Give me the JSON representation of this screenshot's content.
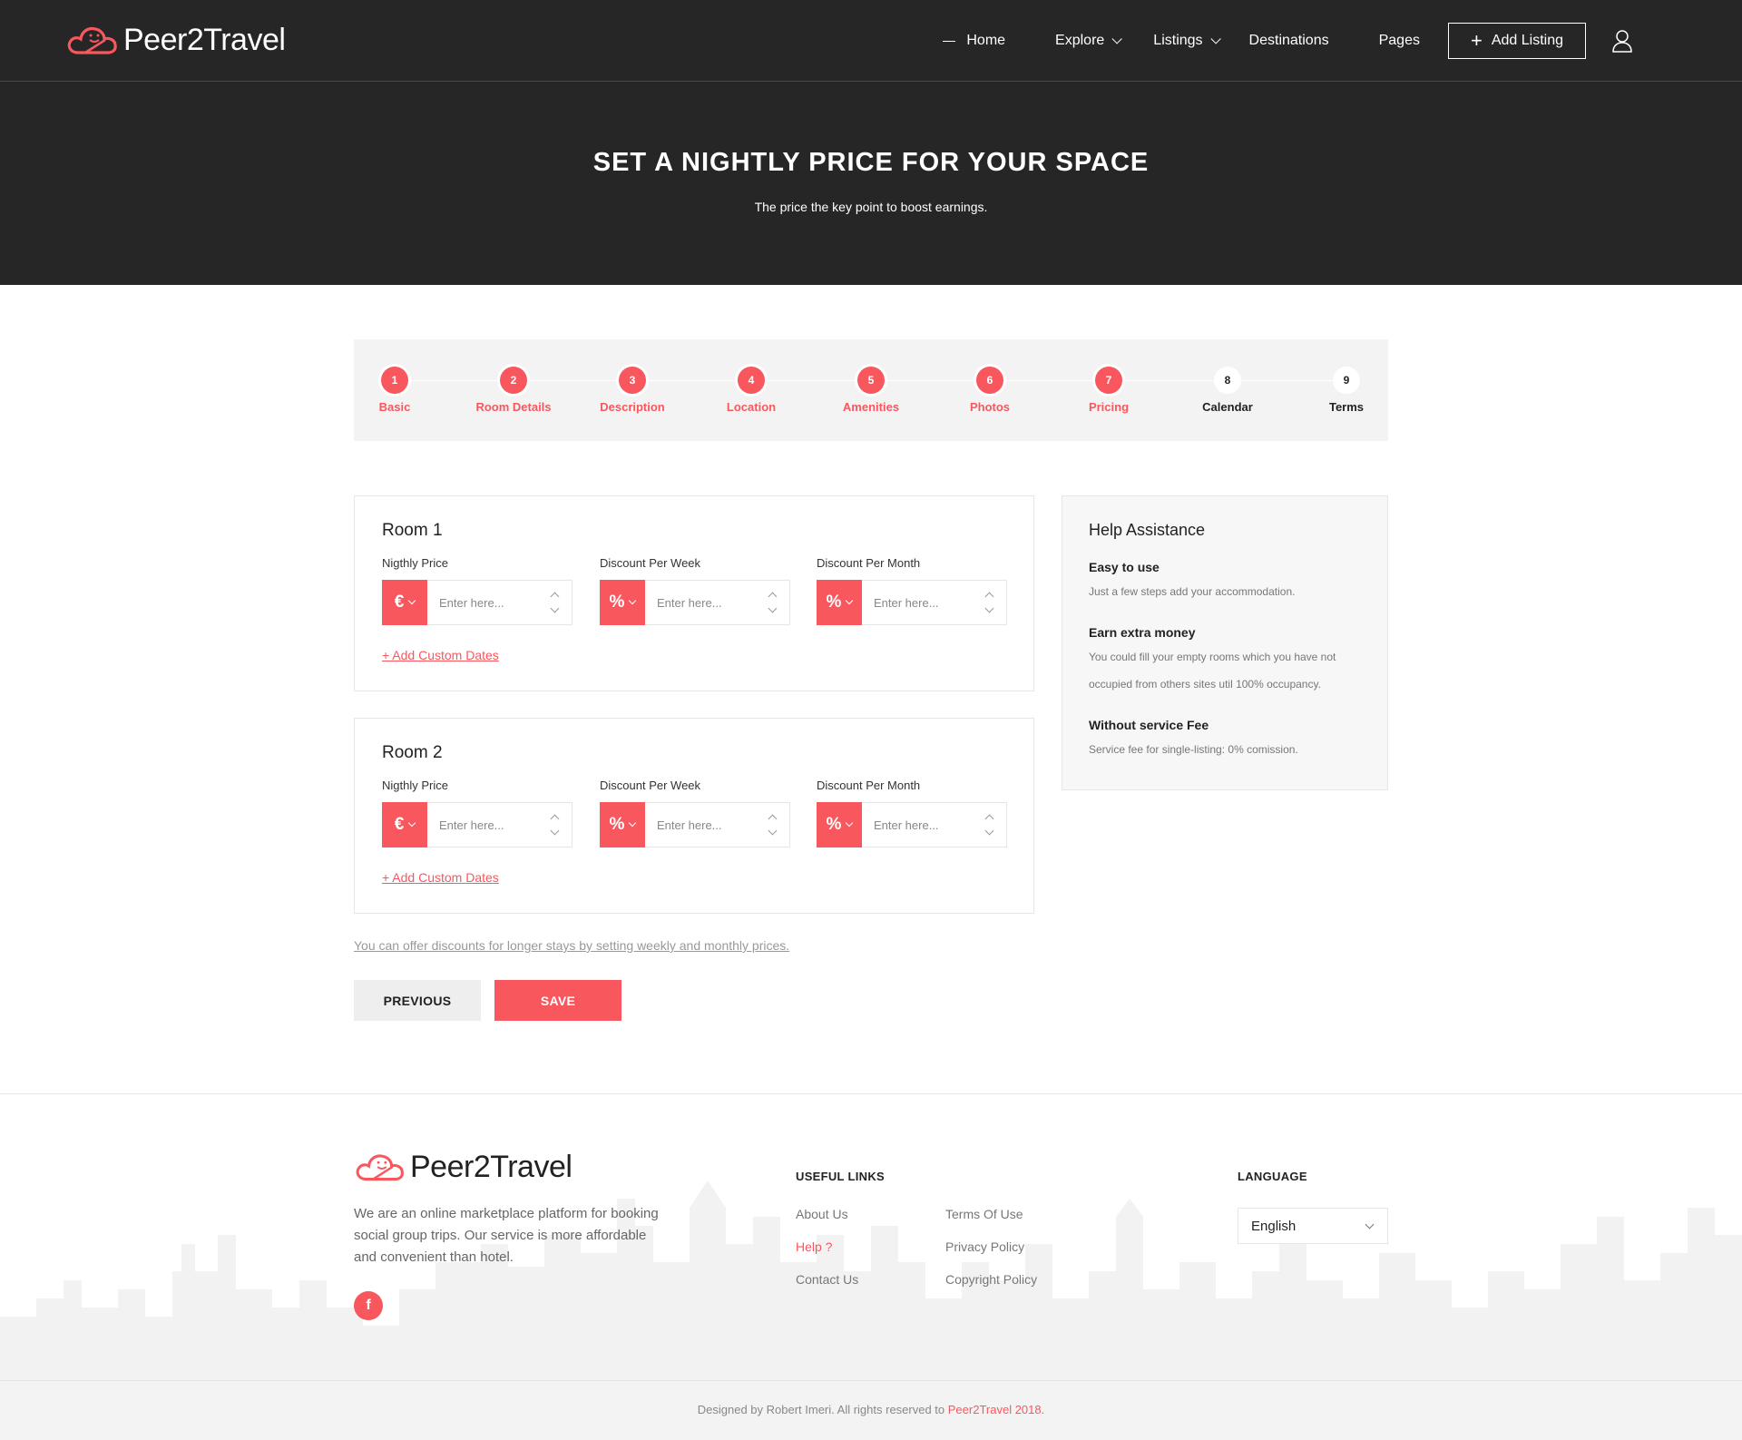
{
  "brand": {
    "name": "Peer2Travel",
    "accent": "#f9575e",
    "dark": "#262626"
  },
  "nav": {
    "items": [
      {
        "label": "Home",
        "dropdown": false,
        "active": true
      },
      {
        "label": "Explore",
        "dropdown": true
      },
      {
        "label": "Listings",
        "dropdown": true
      },
      {
        "label": "Destinations",
        "dropdown": false
      },
      {
        "label": "Pages",
        "dropdown": false
      }
    ],
    "add_listing": "Add Listing",
    "user_icon": "user-icon"
  },
  "hero": {
    "title": "SET A NIGHTLY PRICE FOR YOUR SPACE",
    "subtitle": "The price the key point to boost earnings."
  },
  "steps": [
    {
      "num": "1",
      "label": "Basic",
      "done": true
    },
    {
      "num": "2",
      "label": "Room Details",
      "done": true
    },
    {
      "num": "3",
      "label": "Description",
      "done": true
    },
    {
      "num": "4",
      "label": "Location",
      "done": true
    },
    {
      "num": "5",
      "label": "Amenities",
      "done": true
    },
    {
      "num": "6",
      "label": "Photos",
      "done": true
    },
    {
      "num": "7",
      "label": "Pricing",
      "done": true
    },
    {
      "num": "8",
      "label": "Calendar",
      "done": false
    },
    {
      "num": "9",
      "label": "Terms",
      "done": false
    }
  ],
  "rooms": [
    {
      "title": "Room 1",
      "fields": [
        {
          "label": "Nigthly Price",
          "unit": "€",
          "placeholder": "Enter here...",
          "value": ""
        },
        {
          "label": "Discount Per Week",
          "unit": "%",
          "placeholder": "Enter here...",
          "value": ""
        },
        {
          "label": "Discount Per Month",
          "unit": "%",
          "placeholder": "Enter here...",
          "value": ""
        }
      ],
      "custom_dates": "+ Add Custom Dates"
    },
    {
      "title": "Room 2",
      "fields": [
        {
          "label": "Nigthly Price",
          "unit": "€",
          "placeholder": "Enter here...",
          "value": ""
        },
        {
          "label": "Discount Per Week",
          "unit": "%",
          "placeholder": "Enter here...",
          "value": ""
        },
        {
          "label": "Discount Per Month",
          "unit": "%",
          "placeholder": "Enter here...",
          "value": ""
        }
      ],
      "custom_dates": "+ Add Custom Dates"
    }
  ],
  "note": "You can offer discounts for longer stays by setting weekly and monthly prices.",
  "buttons": {
    "previous": "PREVIOUS",
    "save": "SAVE"
  },
  "help": {
    "title": "Help Assistance",
    "items": [
      {
        "title": "Easy to use",
        "desc": "Just a few steps add your accommodation."
      },
      {
        "title": "Earn extra money",
        "desc": "You could fill your empty rooms which you have not occupied from others sites util 100% occupancy."
      },
      {
        "title": "Without service Fee",
        "desc": "Service fee for single-listing: 0% comission."
      }
    ]
  },
  "footer": {
    "description": "We are an online marketplace platform for booking social group trips. Our service is more affordable and convenient than hotel.",
    "social_icon": "facebook-icon",
    "social_glyph": "f",
    "useful_links_title": "USEFUL LINKS",
    "links_col1": [
      "About Us",
      "Help ?",
      "Contact Us"
    ],
    "links_col2": [
      "Terms Of Use",
      "Privacy Policy",
      "Copyright Policy"
    ],
    "active_link": "Help ?",
    "language_title": "LANGUAGE",
    "language_value": "English"
  },
  "copyright": {
    "prefix": "Designed by Robert Imeri. All rights reserved to ",
    "brand": "Peer2Travel 2018",
    "suffix": "."
  }
}
